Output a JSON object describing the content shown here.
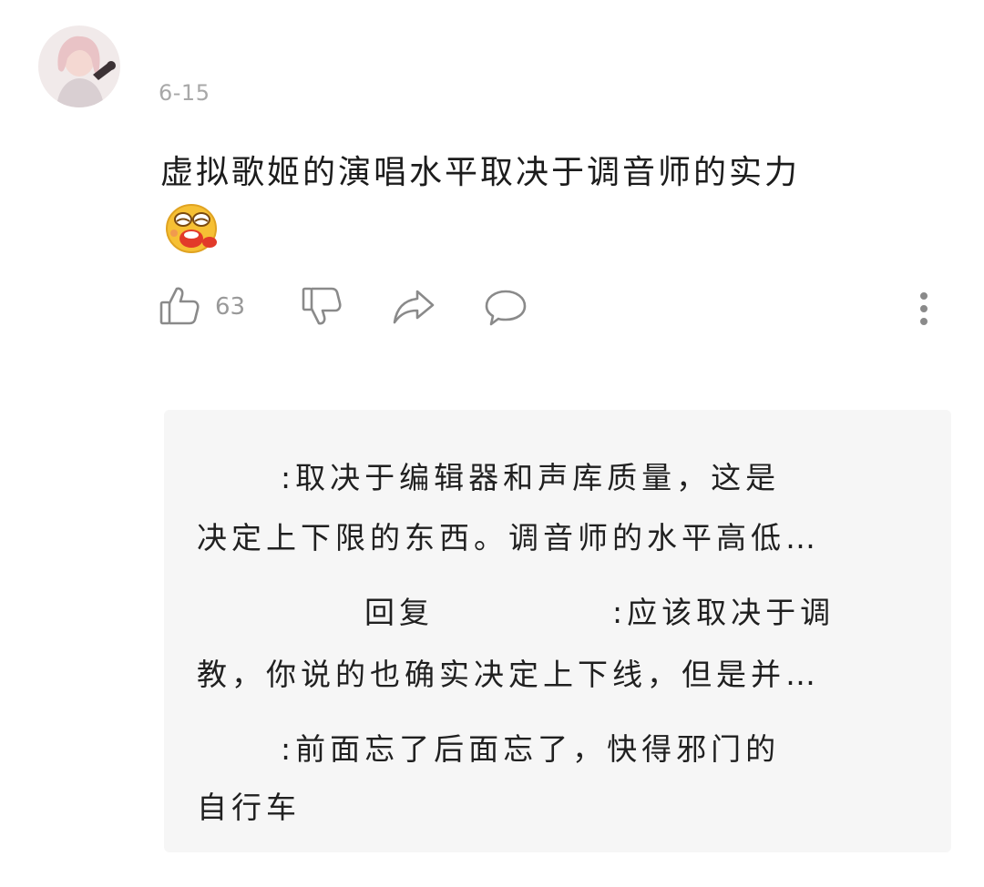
{
  "comment": {
    "date": "6-15",
    "text": "虚拟歌姬的演唱水平取决于调音师的实力",
    "emoji": "laughing-face-emoji"
  },
  "actions": {
    "like_count": "63",
    "icons": [
      "thumbs-up-icon",
      "thumbs-down-icon",
      "share-icon",
      "comment-bubble-icon",
      "more-vertical-icon"
    ]
  },
  "replies": [
    {
      "author": "",
      "lines": [
        ":取决于编辑器和声库质量，这是",
        "决定上下限的东西。调音师的水平高低…"
      ]
    },
    {
      "author": "",
      "reply_word": "回复",
      "reply_to": "",
      "lines": [
        ":应该取决于调",
        "教，你说的也确实决定上下线，但是并…"
      ]
    },
    {
      "author": "",
      "lines": [
        ":前面忘了后面忘了，快得邪门的",
        "自行车"
      ]
    }
  ],
  "colors": {
    "reply_background": "#f6f6f6",
    "meta_gray": "#a8a8a8",
    "icon_gray": "#8a8a8a",
    "emoji_yellow": "#f6c034"
  }
}
